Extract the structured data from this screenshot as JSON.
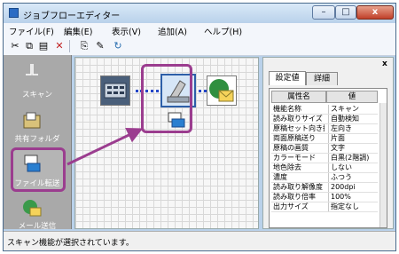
{
  "window": {
    "title": "ジョブフローエディター",
    "controls": {
      "minimize": "–",
      "maximize": "□",
      "close": "x"
    }
  },
  "menu": [
    "ファイル(F)",
    "編集(E)",
    "表示(V)",
    "追加(A)",
    "ヘルプ(H)"
  ],
  "toolbar_icons": [
    "cut-icon",
    "copy-icon",
    "paste-icon",
    "delete-icon",
    "new-icon",
    "edit-icon",
    "help-icon"
  ],
  "left_panel": {
    "items": [
      {
        "label": "スキャン"
      },
      {
        "label": "共有フォルダ"
      },
      {
        "label": "ファイル転送"
      },
      {
        "label": "メール送信"
      }
    ]
  },
  "properties": {
    "tabs": [
      "設定値",
      "詳細"
    ],
    "headers": [
      "属性名",
      "値"
    ],
    "rows": [
      {
        "name": "機能名称",
        "value": "スキャン"
      },
      {
        "name": "読み取りサイズ",
        "value": "自動検知"
      },
      {
        "name": "原稿セット向き指",
        "value": "左向き"
      },
      {
        "name": "両面原稿送り",
        "value": "片面"
      },
      {
        "name": "原稿の画質",
        "value": "文字"
      },
      {
        "name": "カラーモード",
        "value": "白黒(2階調)"
      },
      {
        "name": "地色除去",
        "value": "しない"
      },
      {
        "name": "濃度",
        "value": "ふつう"
      },
      {
        "name": "読み取り解像度",
        "value": "200dpi"
      },
      {
        "name": "読み取り倍率",
        "value": "100%"
      },
      {
        "name": "出力サイズ",
        "value": "指定なし"
      }
    ],
    "close_label": "x"
  },
  "status": "スキャン機能が選択されています。",
  "colors": {
    "highlight": "#9b3d8f",
    "connector": "#2447c8",
    "panel": "#a9a9a9"
  }
}
